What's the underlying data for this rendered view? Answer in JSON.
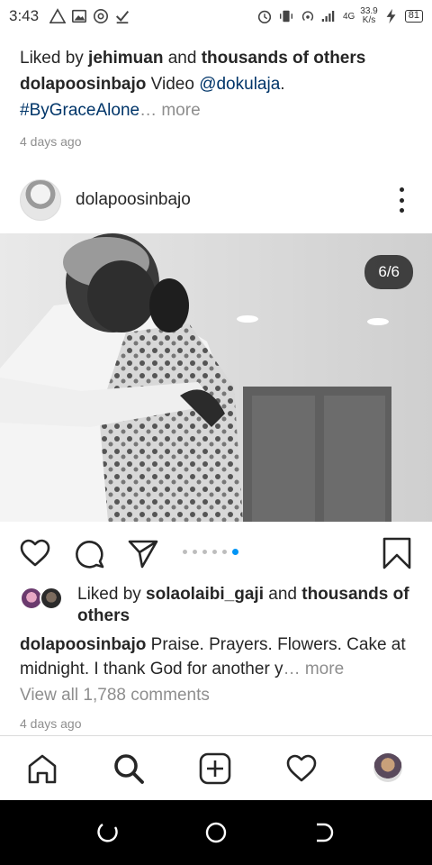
{
  "status_bar": {
    "time": "3:43",
    "network_label": "4G",
    "speed_value": "33.9",
    "speed_unit": "K/s",
    "battery": "81",
    "icons": [
      "warning-icon",
      "image-icon",
      "at-icon",
      "download-check-icon",
      "alarm-icon",
      "vibrate-icon",
      "hotspot-icon",
      "signal-icon",
      "charging-icon"
    ]
  },
  "prev_post": {
    "liked_prefix": "Liked by ",
    "liked_user": "jehimuan",
    "liked_and": " and ",
    "liked_others": "thousands of others",
    "caption_user": "dolapoosinbajo",
    "caption_text": " Video ",
    "caption_mention": "@dokulaja",
    "caption_period": ".",
    "caption_hashtag": "#ByGraceAlone",
    "caption_ellipsis": "… more",
    "time_ago": "4 days ago"
  },
  "post": {
    "username": "dolapoosinbajo",
    "image_counter": "6/6",
    "carousel": {
      "count": 6,
      "active_index": 5
    },
    "liked_prefix": "Liked by ",
    "liked_user": "solaolaibi_gaji",
    "liked_and": " and ",
    "liked_others": "thousands of others",
    "caption_user": "dolapoosinbajo",
    "caption_text": " Praise. Prayers. Flowers. Cake at midnight. I thank God for another y",
    "caption_more": "… more",
    "view_all_comments": "View all 1,788 comments",
    "time_ago": "4 days ago"
  },
  "bottom_nav": [
    "home-icon",
    "search-icon",
    "add-post-icon",
    "heart-icon",
    "profile-avatar"
  ],
  "colors": {
    "link": "#003569",
    "muted": "#8e8e8e",
    "active_dot": "#0095f6",
    "text": "#262626"
  }
}
